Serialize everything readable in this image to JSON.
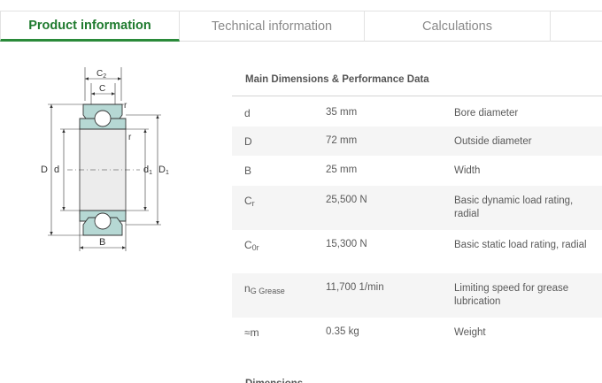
{
  "tabs": [
    {
      "label": "Product information",
      "active": true
    },
    {
      "label": "Technical information",
      "active": false
    },
    {
      "label": "Calculations",
      "active": false
    },
    {
      "label": "",
      "active": false
    }
  ],
  "diagram": {
    "labels": {
      "C2": "C",
      "C2_sub": "2",
      "C": "C",
      "r_top": "r",
      "r_mid": "r",
      "D": "D",
      "d": "d",
      "d1": "d",
      "d1_sub": "1",
      "D1": "D",
      "D1_sub": "1",
      "B": "B"
    },
    "colors": {
      "ring": "#b6d8d4",
      "outline": "#333333",
      "ball": "#ffffff"
    }
  },
  "main": {
    "section_title": "Main Dimensions & Performance Data",
    "rows": [
      {
        "symbol": "d",
        "symbol_sub": "",
        "value": "35 mm",
        "description": "Bore diameter"
      },
      {
        "symbol": "D",
        "symbol_sub": "",
        "value": "72 mm",
        "description": "Outside diameter"
      },
      {
        "symbol": "B",
        "symbol_sub": "",
        "value": "25 mm",
        "description": "Width"
      },
      {
        "symbol": "C",
        "symbol_sub": "r",
        "value": "25,500 N",
        "description": "Basic dynamic load rating, radial"
      },
      {
        "symbol": "C",
        "symbol_sub": "0r",
        "value": "15,300 N",
        "description": "Basic static load rating, radial"
      },
      {
        "symbol": "n",
        "symbol_sub": "G Grease",
        "value": "11,700 1/min",
        "description": "Limiting speed for grease lubrication"
      },
      {
        "symbol": "≈m",
        "symbol_sub": "",
        "value": "0.35 kg",
        "description": "Weight"
      }
    ],
    "next_section_partial": "Dimensions"
  }
}
